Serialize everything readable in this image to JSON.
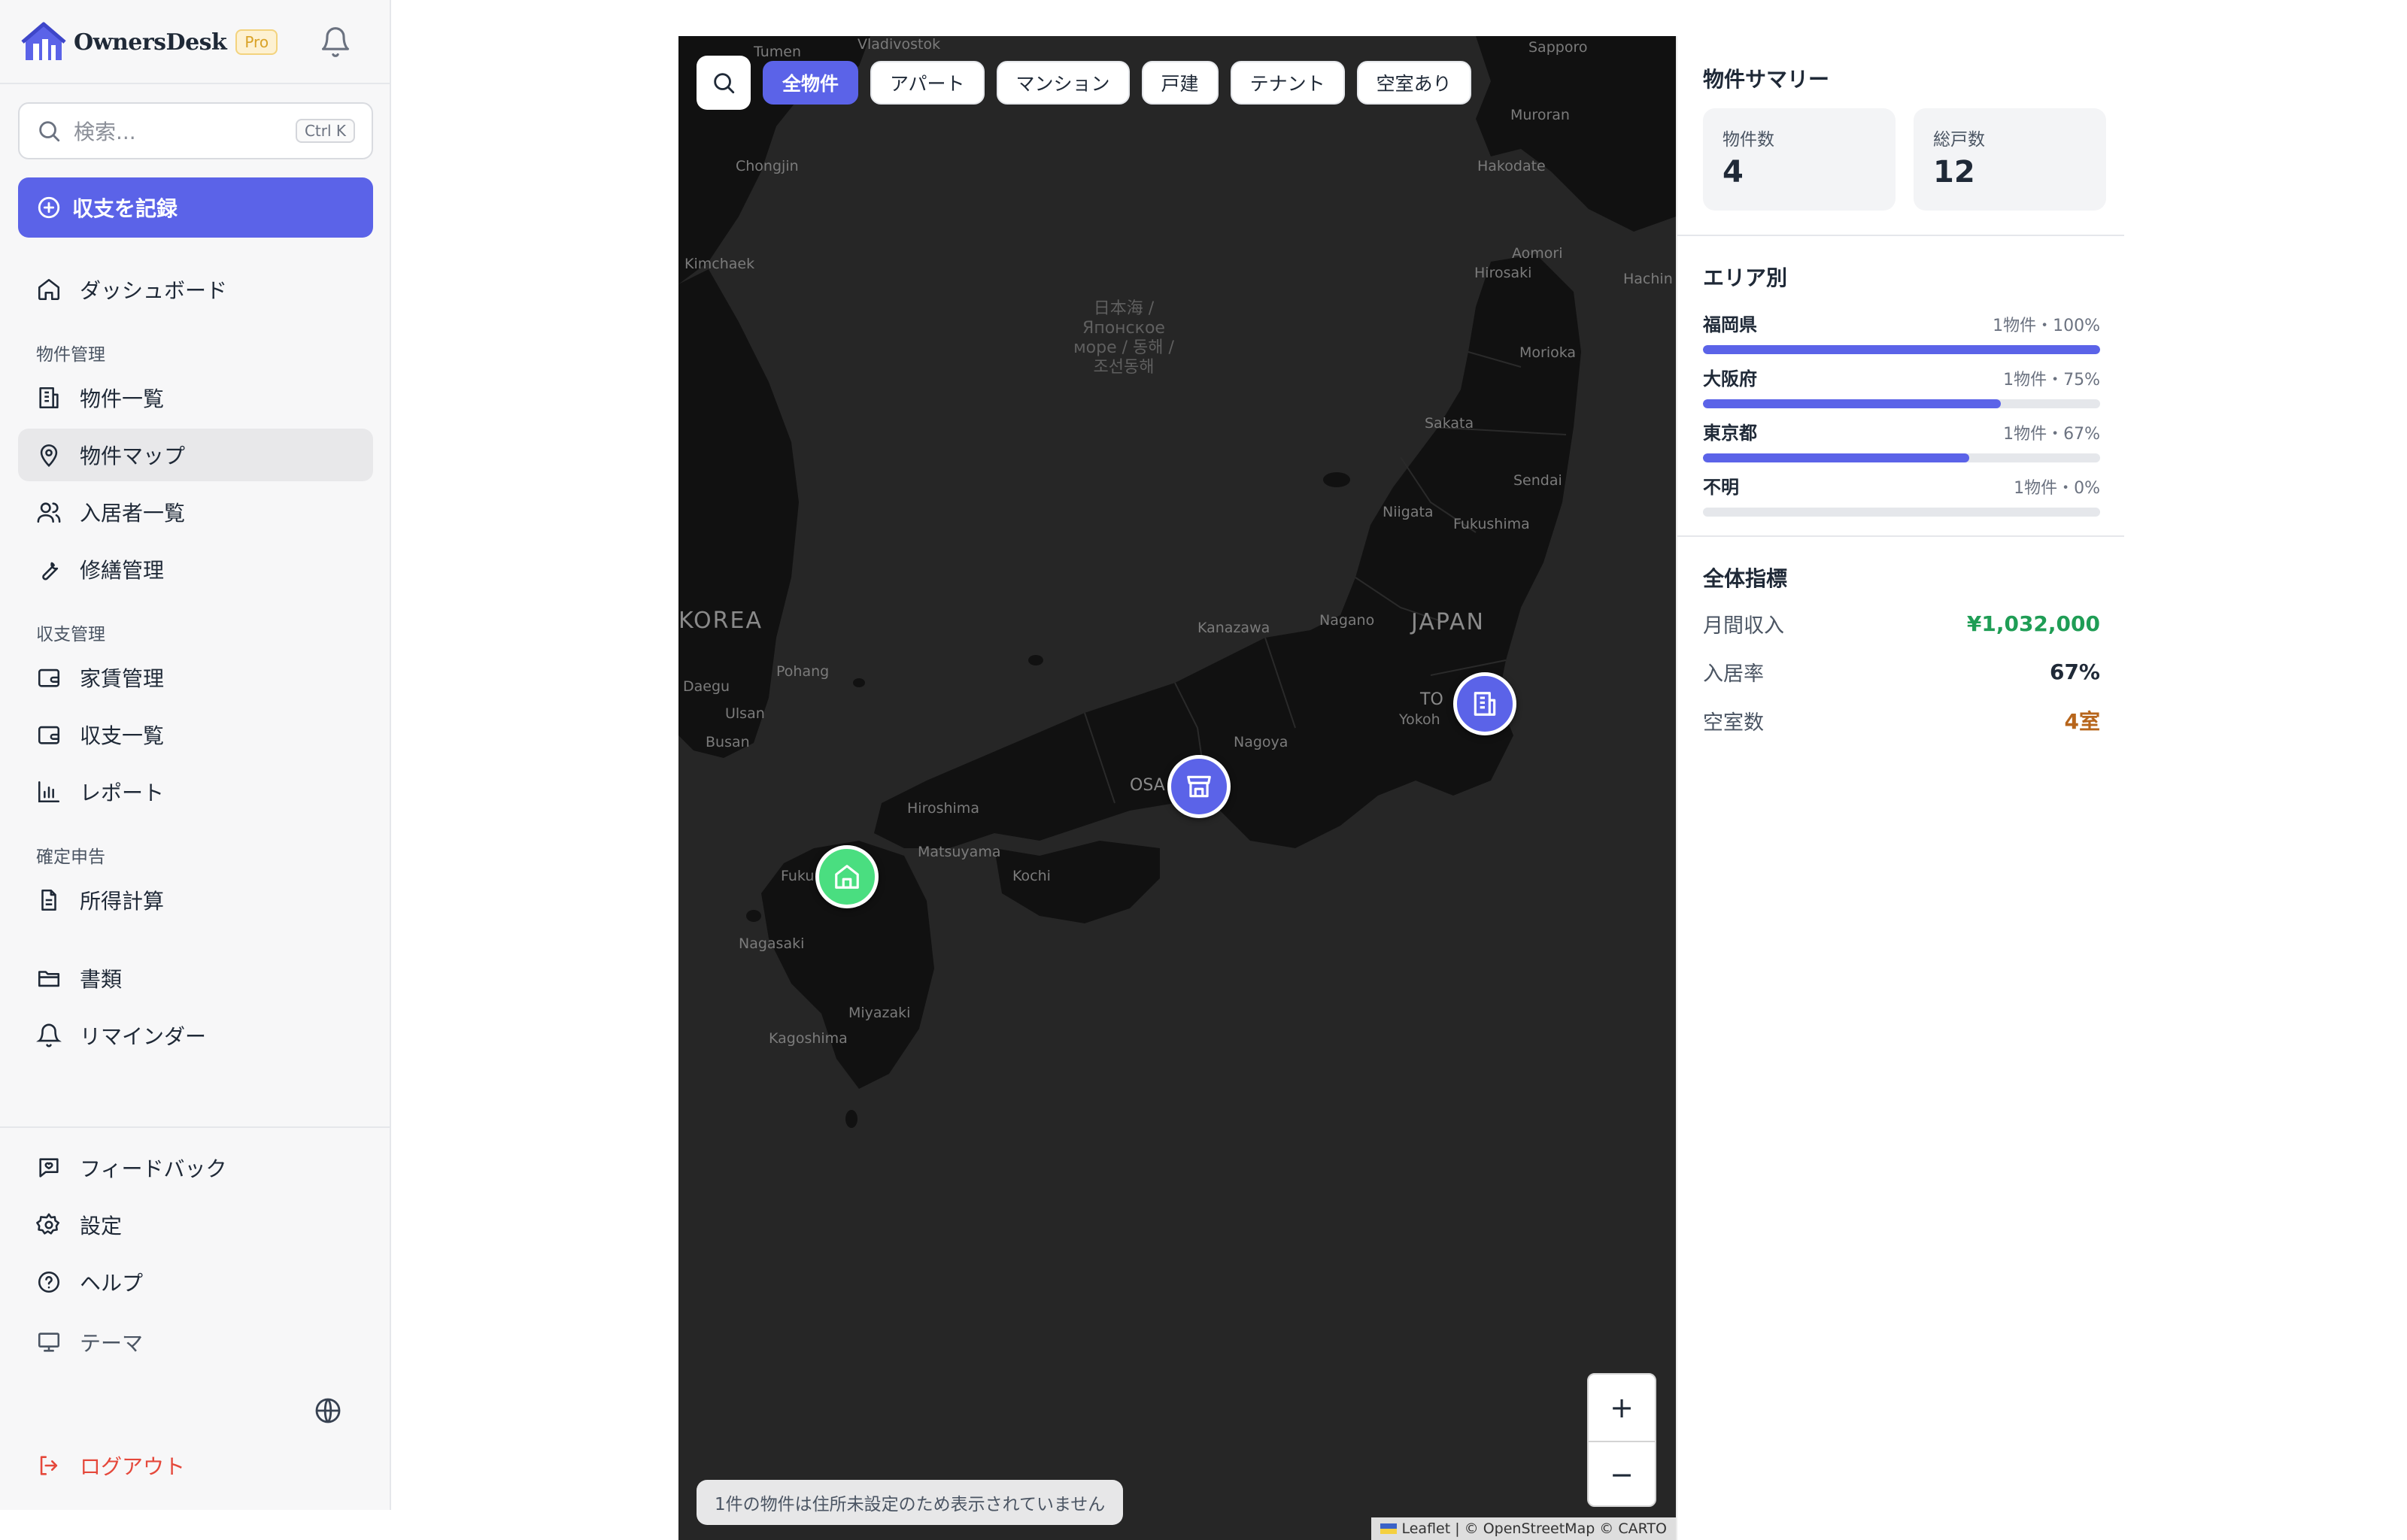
{
  "app": {
    "name": "OwnersDesk",
    "badge": "Pro"
  },
  "sidebar": {
    "search_placeholder": "検索...",
    "search_shortcut": "Ctrl K",
    "record_button": "収支を記録",
    "dashboard": "ダッシュボード",
    "sections": {
      "property": "物件管理",
      "finance": "収支管理",
      "tax": "確定申告"
    },
    "items": {
      "property_list": "物件一覧",
      "property_map": "物件マップ",
      "tenant_list": "入居者一覧",
      "repair": "修繕管理",
      "rent": "家賃管理",
      "income_expense": "収支一覧",
      "report": "レポート",
      "income_calc": "所得計算",
      "documents": "書類",
      "reminder": "リマインダー"
    },
    "footer": {
      "feedback": "フィードバック",
      "settings": "設定",
      "help": "ヘルプ",
      "theme": "テーマ",
      "logout": "ログアウト"
    }
  },
  "map": {
    "filters": [
      "全物件",
      "アパート",
      "マンション",
      "戸建",
      "テナント",
      "空室あり"
    ],
    "active_filter": "全物件",
    "labels": {
      "sea": "日本海 / Японское море / 동해 / 조선동해",
      "japan": "JAPAN",
      "korea": "KOREA",
      "osaka": "OSA",
      "tokyo": "TO",
      "yokohama": "Yokoh",
      "fukuoka": "Fuku",
      "cities": [
        "Tumen",
        "Vladivostok",
        "Sapporo",
        "Muroran",
        "Hakodate",
        "Chongjin",
        "Kimchaek",
        "Aomori",
        "Hirosaki",
        "Hachin",
        "Morioka",
        "Sakata",
        "Sendai",
        "Niigata",
        "Fukushima",
        "Kanazawa",
        "Nagano",
        "Pohang",
        "Daegu",
        "Ulsan",
        "Busan",
        "Nagoya",
        "Hiroshima",
        "Matsuyama",
        "Kochi",
        "Nagasaki",
        "Miyazaki",
        "Kagoshima"
      ]
    },
    "pins": [
      {
        "name": "fukuoka",
        "type": "house-icon",
        "color": "#4ade80"
      },
      {
        "name": "osaka",
        "type": "store-icon",
        "color": "#5b63e8"
      },
      {
        "name": "tokyo",
        "type": "building-icon",
        "color": "#5b63e8"
      }
    ],
    "zoom_in": "+",
    "zoom_out": "−",
    "notice": "1件の物件は住所未設定のため表示されていません",
    "attribution": "Leaflet | © OpenStreetMap © CARTO"
  },
  "summary": {
    "title": "物件サマリー",
    "property_count_label": "物件数",
    "property_count": "4",
    "units_label": "総戸数",
    "units": "12"
  },
  "areas": {
    "title": "エリア別",
    "rows": [
      {
        "name": "福岡県",
        "meta": "1物件・100%",
        "pct": 100
      },
      {
        "name": "大阪府",
        "meta": "1物件・75%",
        "pct": 75
      },
      {
        "name": "東京都",
        "meta": "1物件・67%",
        "pct": 67
      },
      {
        "name": "不明",
        "meta": "1物件・0%",
        "pct": 0
      }
    ]
  },
  "metrics": {
    "title": "全体指標",
    "monthly_income_label": "月間収入",
    "monthly_income": "¥1,032,000",
    "occupancy_label": "入居率",
    "occupancy": "67%",
    "vacancy_label": "空室数",
    "vacancy": "4室"
  },
  "colors": {
    "accent": "#5b63e8",
    "income": "#1f9d55",
    "vacancy": "#b7651b",
    "logout": "#e5483b"
  }
}
